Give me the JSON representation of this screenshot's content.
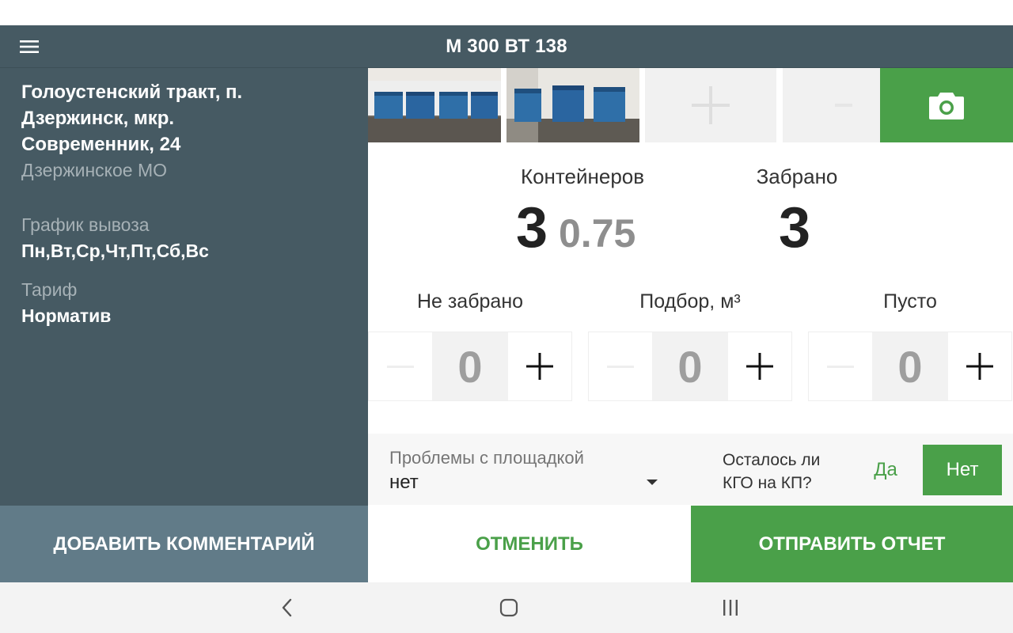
{
  "toolbar": {
    "title": "М 300 ВТ 138",
    "menu_icon": "hamburger-menu-icon"
  },
  "sidebar": {
    "address_line1": "Голоустенский тракт, п.",
    "address_line2": "Дзержинск, мкр.",
    "address_line3": "Современник, 24",
    "district": "Дзержинское МО",
    "schedule_label": "График вывоза",
    "schedule_value": "Пн,Вт,Ср,Чт,Пт,Сб,Вс",
    "tariff_label": "Тариф",
    "tariff_value": "Норматив",
    "add_comment_label": "ДОБАВИТЬ КОММЕНТАРИЙ"
  },
  "photos": {
    "filled_count": 2,
    "empty_slot_icon": "plus-icon",
    "camera_icon": "camera-icon"
  },
  "stats": {
    "containers_label": "Контейнеров",
    "containers_count": "3",
    "containers_volume": "0.75",
    "collected_label": "Забрано",
    "collected_count": "3"
  },
  "counters": [
    {
      "label": "Не забрано",
      "value": "0"
    },
    {
      "label": "Подбор, м³",
      "value": "0"
    },
    {
      "label": "Пусто",
      "value": "0"
    }
  ],
  "problems": {
    "label": "Проблемы с площадкой",
    "value": "нет"
  },
  "kgo": {
    "question_line1": "Осталось ли",
    "question_line2": "КГО на КП?",
    "yes_label": "Да",
    "no_label": "Нет",
    "selected": "Нет"
  },
  "actions": {
    "cancel_label": "ОТМЕНИТЬ",
    "send_label": "ОТПРАВИТЬ ОТЧЕТ"
  },
  "colors": {
    "toolbar_bg": "#465a63",
    "sidebar_bg": "#465a63",
    "comment_bg": "#617b88",
    "accent_green": "#4aa049"
  },
  "navbar": {
    "back_icon": "back-chevron-icon",
    "home_icon": "home-icon",
    "recents_icon": "recent-apps-icon"
  }
}
